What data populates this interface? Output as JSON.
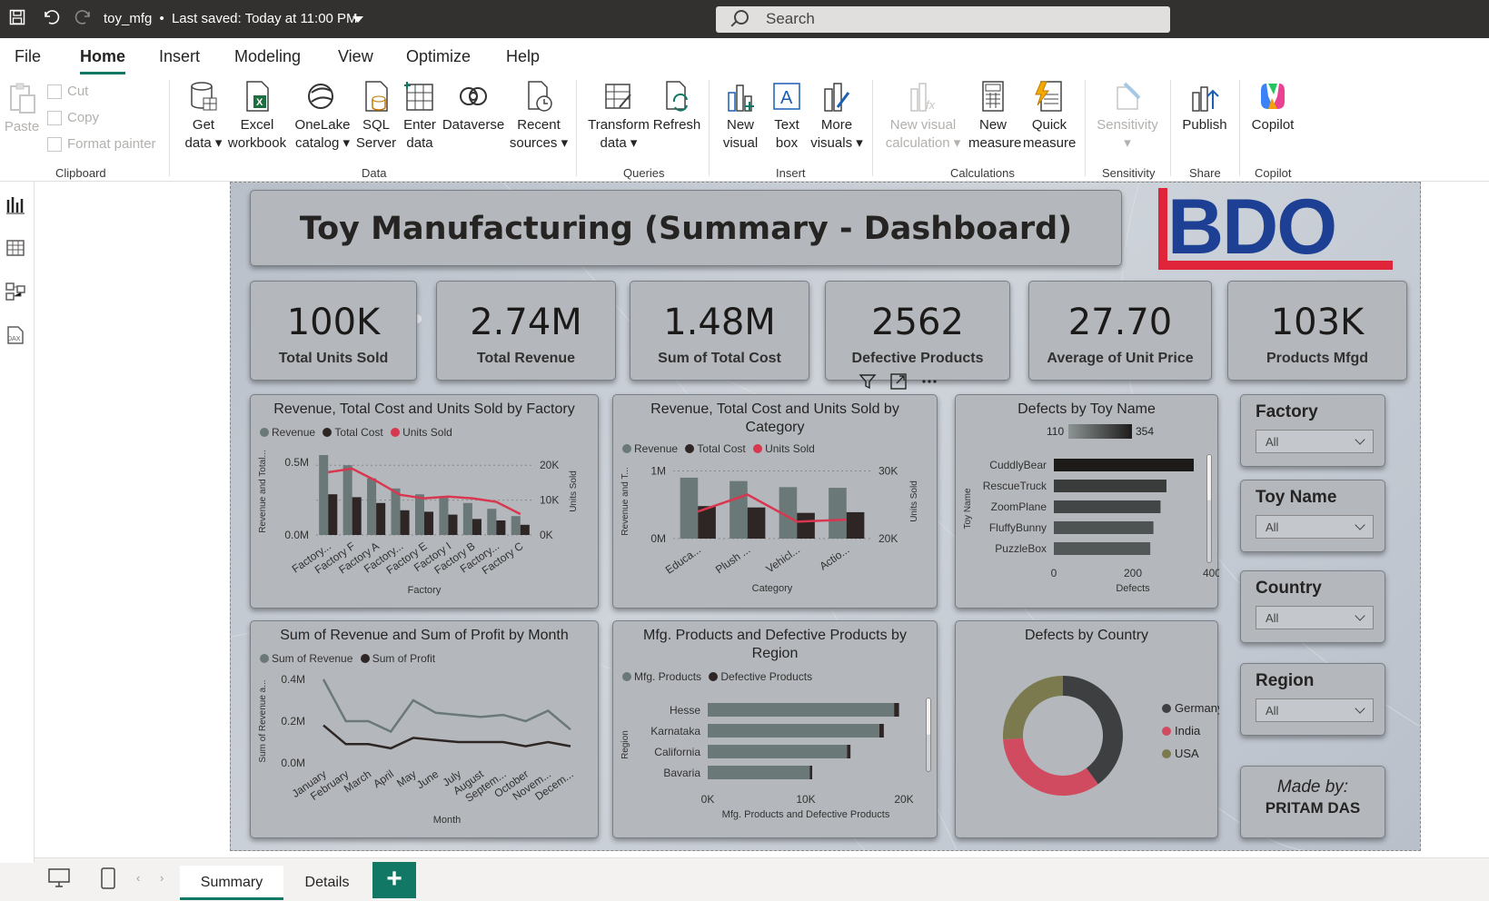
{
  "titlebar": {
    "filename": "toy_mfg",
    "bullet": "•",
    "saved": "Last saved: Today at 11:00 PM",
    "search_placeholder": "Search"
  },
  "menu": {
    "tabs": [
      "File",
      "Home",
      "Insert",
      "Modeling",
      "View",
      "Optimize",
      "Help"
    ],
    "active": "Home"
  },
  "ribbon": {
    "clipboard": {
      "paste": "Paste",
      "cut": "Cut",
      "copy": "Copy",
      "format_painter": "Format painter",
      "group": "Clipboard"
    },
    "data": {
      "get_data": [
        "Get",
        "data"
      ],
      "excel": [
        "Excel",
        "workbook"
      ],
      "onelake": [
        "OneLake",
        "catalog"
      ],
      "sql": [
        "SQL",
        "Server"
      ],
      "enter": [
        "Enter",
        "data"
      ],
      "dataverse": [
        "Dataverse"
      ],
      "recent": [
        "Recent",
        "sources"
      ],
      "group": "Data"
    },
    "queries": {
      "transform": [
        "Transform",
        "data"
      ],
      "refresh": [
        "Refresh"
      ],
      "group": "Queries"
    },
    "insert": {
      "new_visual": [
        "New",
        "visual"
      ],
      "text_box": [
        "Text",
        "box"
      ],
      "more_visuals": [
        "More",
        "visuals"
      ],
      "group": "Insert"
    },
    "calculations": {
      "new_visual_calc": [
        "New visual",
        "calculation"
      ],
      "new_measure": [
        "New",
        "measure"
      ],
      "quick_measure": [
        "Quick",
        "measure"
      ],
      "group": "Calculations"
    },
    "sensitivity": {
      "label": [
        "Sensitivity"
      ],
      "group": "Sensitivity"
    },
    "share": {
      "publish": [
        "Publish"
      ],
      "group": "Share"
    },
    "copilot": {
      "label": [
        "Copilot"
      ],
      "group": "Copilot"
    }
  },
  "report": {
    "title": "Toy Manufacturing (Summary - Dashboard)",
    "logo": "BDO",
    "kpis": [
      {
        "value": "100K",
        "label": "Total Units Sold"
      },
      {
        "value": "2.74M",
        "label": "Total Revenue"
      },
      {
        "value": "1.48M",
        "label": "Sum of Total Cost"
      },
      {
        "value": "2562",
        "label": "Defective Products"
      },
      {
        "value": "27.70",
        "label": "Average of Unit Price"
      },
      {
        "value": "103K",
        "label": "Products Mfgd"
      }
    ],
    "slicers": [
      {
        "title": "Factory",
        "value": "All"
      },
      {
        "title": "Toy Name",
        "value": "All"
      },
      {
        "title": "Country",
        "value": "All"
      },
      {
        "title": "Region",
        "value": "All"
      }
    ],
    "made_by": {
      "line1": "Made by:",
      "line2": "PRITAM DAS"
    }
  },
  "colors": {
    "revenue": "#6b7878",
    "cost": "#2e2624",
    "units": "#d9364f",
    "germany": "#3d3f40",
    "india": "#d14b60",
    "usa": "#7a7a4e",
    "accent": "#117865"
  },
  "chart_data": [
    {
      "type": "bar",
      "title": "Revenue, Total Cost and Units Sold by Factory",
      "xlabel": "Factory",
      "ylabel": "Revenue and Total...",
      "y2label": "Units Sold",
      "categories": [
        "Factory...",
        "Factory F",
        "Factory A",
        "Factory...",
        "Factory E",
        "Factory I",
        "Factory B",
        "Factory...",
        "Factory C"
      ],
      "yticks": [
        "0.0M",
        "0.5M"
      ],
      "y2ticks": [
        "0K",
        "10K",
        "20K"
      ],
      "ylim": [
        0,
        0.6
      ],
      "y2lim": [
        0,
        25
      ],
      "series": [
        {
          "name": "Revenue",
          "values": [
            0.55,
            0.48,
            0.39,
            0.32,
            0.28,
            0.26,
            0.22,
            0.18,
            0.13
          ]
        },
        {
          "name": "Total Cost",
          "values": [
            0.28,
            0.26,
            0.22,
            0.17,
            0.16,
            0.14,
            0.11,
            0.1,
            0.07
          ]
        },
        {
          "name": "Units Sold",
          "values": [
            18,
            19,
            15.5,
            11.5,
            10.5,
            11,
            10.5,
            9.5,
            6
          ]
        }
      ]
    },
    {
      "type": "bar",
      "title": "Revenue, Total Cost and Units Sold by Category",
      "xlabel": "Category",
      "ylabel": "Revenue and T...",
      "y2label": "Units Sold",
      "categories": [
        "Educa...",
        "Plush ...",
        "Vehicl...",
        "Actio..."
      ],
      "yticks": [
        "0M",
        "1M"
      ],
      "y2ticks": [
        "20K",
        "30K"
      ],
      "ylim": [
        0,
        1.1
      ],
      "y2lim": [
        20,
        31
      ],
      "series": [
        {
          "name": "Revenue",
          "values": [
            0.9,
            0.85,
            0.76,
            0.75
          ]
        },
        {
          "name": "Total Cost",
          "values": [
            0.48,
            0.46,
            0.38,
            0.39
          ]
        },
        {
          "name": "Units Sold",
          "values": [
            24.0,
            26.5,
            22.5,
            22.8
          ]
        }
      ]
    },
    {
      "type": "bar",
      "title": "Defects by Toy Name",
      "xlabel": "Defects",
      "ylabel": "Toy Name",
      "gradient_min": "110",
      "gradient_max": "354",
      "categories": [
        "CuddlyBear",
        "RescueTruck",
        "ZoomPlane",
        "FluffyBunny",
        "PuzzleBox"
      ],
      "xticks": [
        "0",
        "200",
        "400"
      ],
      "xlim": [
        0,
        400
      ],
      "values": [
        354,
        285,
        270,
        252,
        244
      ]
    },
    {
      "type": "line",
      "title": "Sum of Revenue and Sum of Profit by Month",
      "xlabel": "Month",
      "ylabel": "Sum of Revenue a...",
      "categories": [
        "January",
        "February",
        "March",
        "April",
        "May",
        "June",
        "July",
        "August",
        "Septem...",
        "October",
        "Novem...",
        "Decem..."
      ],
      "yticks": [
        "0.0M",
        "0.2M",
        "0.4M"
      ],
      "ylim": [
        0,
        0.4
      ],
      "series": [
        {
          "name": "Sum of Revenue",
          "values": [
            0.4,
            0.2,
            0.2,
            0.15,
            0.3,
            0.24,
            0.23,
            0.22,
            0.23,
            0.2,
            0.25,
            0.16
          ]
        },
        {
          "name": "Sum of Profit",
          "values": [
            0.18,
            0.09,
            0.09,
            0.07,
            0.12,
            0.11,
            0.1,
            0.1,
            0.1,
            0.08,
            0.1,
            0.08
          ]
        }
      ]
    },
    {
      "type": "bar",
      "title": "Mfg. Products and Defective Products by Region",
      "xlabel": "Mfg. Products and Defective Products",
      "ylabel": "Region",
      "categories": [
        "Hesse",
        "Karnataka",
        "California",
        "Bavaria"
      ],
      "xticks": [
        "0K",
        "10K",
        "20K"
      ],
      "xlim": [
        0,
        20
      ],
      "series": [
        {
          "name": "Mfg. Products",
          "values": [
            19.0,
            17.5,
            14.2,
            10.4
          ]
        },
        {
          "name": "Defective Products",
          "values": [
            0.5,
            0.45,
            0.35,
            0.25
          ]
        }
      ]
    },
    {
      "type": "pie",
      "title": "Defects by Country",
      "categories": [
        "Germany",
        "India",
        "USA"
      ],
      "values": [
        40,
        34,
        26
      ]
    }
  ],
  "bottom": {
    "tabs": [
      "Summary",
      "Details"
    ],
    "active": "Summary",
    "add": "+"
  }
}
